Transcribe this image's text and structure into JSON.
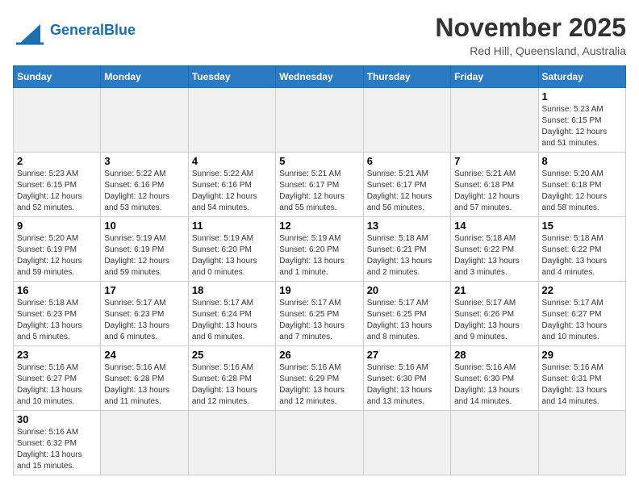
{
  "header": {
    "logo_general": "General",
    "logo_blue": "Blue",
    "month_title": "November 2025",
    "location": "Red Hill, Queensland, Australia"
  },
  "weekdays": [
    "Sunday",
    "Monday",
    "Tuesday",
    "Wednesday",
    "Thursday",
    "Friday",
    "Saturday"
  ],
  "weeks": [
    [
      {
        "day": "",
        "info": ""
      },
      {
        "day": "",
        "info": ""
      },
      {
        "day": "",
        "info": ""
      },
      {
        "day": "",
        "info": ""
      },
      {
        "day": "",
        "info": ""
      },
      {
        "day": "",
        "info": ""
      },
      {
        "day": "1",
        "info": "Sunrise: 5:23 AM\nSunset: 6:15 PM\nDaylight: 12 hours\nand 51 minutes."
      }
    ],
    [
      {
        "day": "2",
        "info": "Sunrise: 5:23 AM\nSunset: 6:15 PM\nDaylight: 12 hours\nand 52 minutes."
      },
      {
        "day": "3",
        "info": "Sunrise: 5:22 AM\nSunset: 6:16 PM\nDaylight: 12 hours\nand 53 minutes."
      },
      {
        "day": "4",
        "info": "Sunrise: 5:22 AM\nSunset: 6:16 PM\nDaylight: 12 hours\nand 54 minutes."
      },
      {
        "day": "5",
        "info": "Sunrise: 5:21 AM\nSunset: 6:17 PM\nDaylight: 12 hours\nand 55 minutes."
      },
      {
        "day": "6",
        "info": "Sunrise: 5:21 AM\nSunset: 6:17 PM\nDaylight: 12 hours\nand 56 minutes."
      },
      {
        "day": "7",
        "info": "Sunrise: 5:21 AM\nSunset: 6:18 PM\nDaylight: 12 hours\nand 57 minutes."
      },
      {
        "day": "8",
        "info": "Sunrise: 5:20 AM\nSunset: 6:18 PM\nDaylight: 12 hours\nand 58 minutes."
      }
    ],
    [
      {
        "day": "9",
        "info": "Sunrise: 5:20 AM\nSunset: 6:19 PM\nDaylight: 12 hours\nand 59 minutes."
      },
      {
        "day": "10",
        "info": "Sunrise: 5:19 AM\nSunset: 6:19 PM\nDaylight: 12 hours\nand 59 minutes."
      },
      {
        "day": "11",
        "info": "Sunrise: 5:19 AM\nSunset: 6:20 PM\nDaylight: 13 hours\nand 0 minutes."
      },
      {
        "day": "12",
        "info": "Sunrise: 5:19 AM\nSunset: 6:20 PM\nDaylight: 13 hours\nand 1 minute."
      },
      {
        "day": "13",
        "info": "Sunrise: 5:18 AM\nSunset: 6:21 PM\nDaylight: 13 hours\nand 2 minutes."
      },
      {
        "day": "14",
        "info": "Sunrise: 5:18 AM\nSunset: 6:22 PM\nDaylight: 13 hours\nand 3 minutes."
      },
      {
        "day": "15",
        "info": "Sunrise: 5:18 AM\nSunset: 6:22 PM\nDaylight: 13 hours\nand 4 minutes."
      }
    ],
    [
      {
        "day": "16",
        "info": "Sunrise: 5:18 AM\nSunset: 6:23 PM\nDaylight: 13 hours\nand 5 minutes."
      },
      {
        "day": "17",
        "info": "Sunrise: 5:17 AM\nSunset: 6:23 PM\nDaylight: 13 hours\nand 6 minutes."
      },
      {
        "day": "18",
        "info": "Sunrise: 5:17 AM\nSunset: 6:24 PM\nDaylight: 13 hours\nand 6 minutes."
      },
      {
        "day": "19",
        "info": "Sunrise: 5:17 AM\nSunset: 6:25 PM\nDaylight: 13 hours\nand 7 minutes."
      },
      {
        "day": "20",
        "info": "Sunrise: 5:17 AM\nSunset: 6:25 PM\nDaylight: 13 hours\nand 8 minutes."
      },
      {
        "day": "21",
        "info": "Sunrise: 5:17 AM\nSunset: 6:26 PM\nDaylight: 13 hours\nand 9 minutes."
      },
      {
        "day": "22",
        "info": "Sunrise: 5:17 AM\nSunset: 6:27 PM\nDaylight: 13 hours\nand 10 minutes."
      }
    ],
    [
      {
        "day": "23",
        "info": "Sunrise: 5:16 AM\nSunset: 6:27 PM\nDaylight: 13 hours\nand 10 minutes."
      },
      {
        "day": "24",
        "info": "Sunrise: 5:16 AM\nSunset: 6:28 PM\nDaylight: 13 hours\nand 11 minutes."
      },
      {
        "day": "25",
        "info": "Sunrise: 5:16 AM\nSunset: 6:28 PM\nDaylight: 13 hours\nand 12 minutes."
      },
      {
        "day": "26",
        "info": "Sunrise: 5:16 AM\nSunset: 6:29 PM\nDaylight: 13 hours\nand 12 minutes."
      },
      {
        "day": "27",
        "info": "Sunrise: 5:16 AM\nSunset: 6:30 PM\nDaylight: 13 hours\nand 13 minutes."
      },
      {
        "day": "28",
        "info": "Sunrise: 5:16 AM\nSunset: 6:30 PM\nDaylight: 13 hours\nand 14 minutes."
      },
      {
        "day": "29",
        "info": "Sunrise: 5:16 AM\nSunset: 6:31 PM\nDaylight: 13 hours\nand 14 minutes."
      }
    ],
    [
      {
        "day": "30",
        "info": "Sunrise: 5:16 AM\nSunset: 6:32 PM\nDaylight: 13 hours\nand 15 minutes."
      },
      {
        "day": "",
        "info": ""
      },
      {
        "day": "",
        "info": ""
      },
      {
        "day": "",
        "info": ""
      },
      {
        "day": "",
        "info": ""
      },
      {
        "day": "",
        "info": ""
      },
      {
        "day": "",
        "info": ""
      }
    ]
  ]
}
